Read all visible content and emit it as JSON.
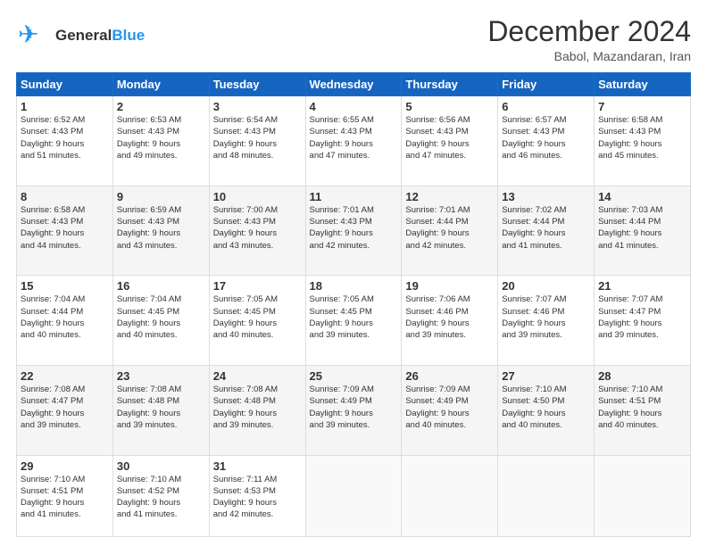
{
  "header": {
    "logo_line1": "General",
    "logo_line2": "Blue",
    "month_title": "December 2024",
    "subtitle": "Babol, Mazandaran, Iran"
  },
  "days_of_week": [
    "Sunday",
    "Monday",
    "Tuesday",
    "Wednesday",
    "Thursday",
    "Friday",
    "Saturday"
  ],
  "weeks": [
    [
      {
        "day": "1",
        "sunrise": "6:52 AM",
        "sunset": "4:43 PM",
        "daylight": "9 hours and 51 minutes."
      },
      {
        "day": "2",
        "sunrise": "6:53 AM",
        "sunset": "4:43 PM",
        "daylight": "9 hours and 49 minutes."
      },
      {
        "day": "3",
        "sunrise": "6:54 AM",
        "sunset": "4:43 PM",
        "daylight": "9 hours and 48 minutes."
      },
      {
        "day": "4",
        "sunrise": "6:55 AM",
        "sunset": "4:43 PM",
        "daylight": "9 hours and 47 minutes."
      },
      {
        "day": "5",
        "sunrise": "6:56 AM",
        "sunset": "4:43 PM",
        "daylight": "9 hours and 47 minutes."
      },
      {
        "day": "6",
        "sunrise": "6:57 AM",
        "sunset": "4:43 PM",
        "daylight": "9 hours and 46 minutes."
      },
      {
        "day": "7",
        "sunrise": "6:58 AM",
        "sunset": "4:43 PM",
        "daylight": "9 hours and 45 minutes."
      }
    ],
    [
      {
        "day": "8",
        "sunrise": "6:58 AM",
        "sunset": "4:43 PM",
        "daylight": "9 hours and 44 minutes."
      },
      {
        "day": "9",
        "sunrise": "6:59 AM",
        "sunset": "4:43 PM",
        "daylight": "9 hours and 43 minutes."
      },
      {
        "day": "10",
        "sunrise": "7:00 AM",
        "sunset": "4:43 PM",
        "daylight": "9 hours and 43 minutes."
      },
      {
        "day": "11",
        "sunrise": "7:01 AM",
        "sunset": "4:43 PM",
        "daylight": "9 hours and 42 minutes."
      },
      {
        "day": "12",
        "sunrise": "7:01 AM",
        "sunset": "4:44 PM",
        "daylight": "9 hours and 42 minutes."
      },
      {
        "day": "13",
        "sunrise": "7:02 AM",
        "sunset": "4:44 PM",
        "daylight": "9 hours and 41 minutes."
      },
      {
        "day": "14",
        "sunrise": "7:03 AM",
        "sunset": "4:44 PM",
        "daylight": "9 hours and 41 minutes."
      }
    ],
    [
      {
        "day": "15",
        "sunrise": "7:04 AM",
        "sunset": "4:44 PM",
        "daylight": "9 hours and 40 minutes."
      },
      {
        "day": "16",
        "sunrise": "7:04 AM",
        "sunset": "4:45 PM",
        "daylight": "9 hours and 40 minutes."
      },
      {
        "day": "17",
        "sunrise": "7:05 AM",
        "sunset": "4:45 PM",
        "daylight": "9 hours and 40 minutes."
      },
      {
        "day": "18",
        "sunrise": "7:05 AM",
        "sunset": "4:45 PM",
        "daylight": "9 hours and 39 minutes."
      },
      {
        "day": "19",
        "sunrise": "7:06 AM",
        "sunset": "4:46 PM",
        "daylight": "9 hours and 39 minutes."
      },
      {
        "day": "20",
        "sunrise": "7:07 AM",
        "sunset": "4:46 PM",
        "daylight": "9 hours and 39 minutes."
      },
      {
        "day": "21",
        "sunrise": "7:07 AM",
        "sunset": "4:47 PM",
        "daylight": "9 hours and 39 minutes."
      }
    ],
    [
      {
        "day": "22",
        "sunrise": "7:08 AM",
        "sunset": "4:47 PM",
        "daylight": "9 hours and 39 minutes."
      },
      {
        "day": "23",
        "sunrise": "7:08 AM",
        "sunset": "4:48 PM",
        "daylight": "9 hours and 39 minutes."
      },
      {
        "day": "24",
        "sunrise": "7:08 AM",
        "sunset": "4:48 PM",
        "daylight": "9 hours and 39 minutes."
      },
      {
        "day": "25",
        "sunrise": "7:09 AM",
        "sunset": "4:49 PM",
        "daylight": "9 hours and 39 minutes."
      },
      {
        "day": "26",
        "sunrise": "7:09 AM",
        "sunset": "4:49 PM",
        "daylight": "9 hours and 40 minutes."
      },
      {
        "day": "27",
        "sunrise": "7:10 AM",
        "sunset": "4:50 PM",
        "daylight": "9 hours and 40 minutes."
      },
      {
        "day": "28",
        "sunrise": "7:10 AM",
        "sunset": "4:51 PM",
        "daylight": "9 hours and 40 minutes."
      }
    ],
    [
      {
        "day": "29",
        "sunrise": "7:10 AM",
        "sunset": "4:51 PM",
        "daylight": "9 hours and 41 minutes."
      },
      {
        "day": "30",
        "sunrise": "7:10 AM",
        "sunset": "4:52 PM",
        "daylight": "9 hours and 41 minutes."
      },
      {
        "day": "31",
        "sunrise": "7:11 AM",
        "sunset": "4:53 PM",
        "daylight": "9 hours and 42 minutes."
      },
      null,
      null,
      null,
      null
    ]
  ],
  "labels": {
    "sunrise": "Sunrise:",
    "sunset": "Sunset:",
    "daylight": "Daylight:"
  }
}
